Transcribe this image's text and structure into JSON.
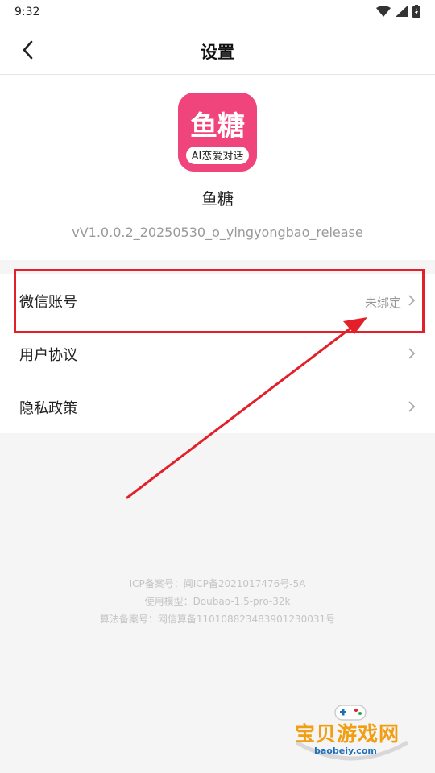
{
  "status_bar": {
    "time": "9:32"
  },
  "nav": {
    "title": "设置"
  },
  "app": {
    "logo_text": "鱼糖",
    "logo_tagline": "AI恋爱对话",
    "name": "鱼糖",
    "version": "vV1.0.0.2_20250530_o_yingyongbao_release"
  },
  "menu": {
    "items": [
      {
        "label": "微信账号",
        "value": "未绑定"
      },
      {
        "label": "用户协议",
        "value": ""
      },
      {
        "label": "隐私政策",
        "value": ""
      }
    ]
  },
  "footer": {
    "icp": "ICP备案号：闽ICP备2021017476号-5A",
    "model": "使用模型：Doubao-1.5-pro-32k",
    "algorithm": "算法备案号：网信算备110108823483901230031号"
  },
  "watermark": {
    "text": "宝贝游戏网",
    "url": "baobeiy.com"
  },
  "colors": {
    "brand": "#f0447d",
    "annotation": "#e3202a",
    "watermark": "#f29e12"
  }
}
